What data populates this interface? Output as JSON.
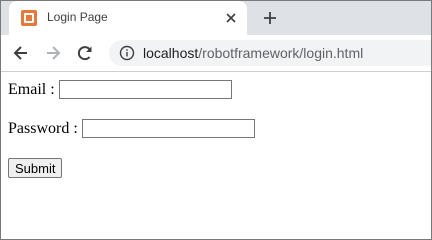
{
  "browser": {
    "tab": {
      "title": "Login Page",
      "favicon": "xampp-icon"
    },
    "toolbar": {
      "url_host": "localhost",
      "url_path": "/robotframework/login.html"
    }
  },
  "form": {
    "email_label": "Email :",
    "email_value": "",
    "password_label": "Password :",
    "password_value": "",
    "submit_label": "Submit"
  },
  "colors": {
    "tab_strip": "#dee1e6",
    "favicon": "#e8773a",
    "omnibox": "#f1f3f4"
  }
}
